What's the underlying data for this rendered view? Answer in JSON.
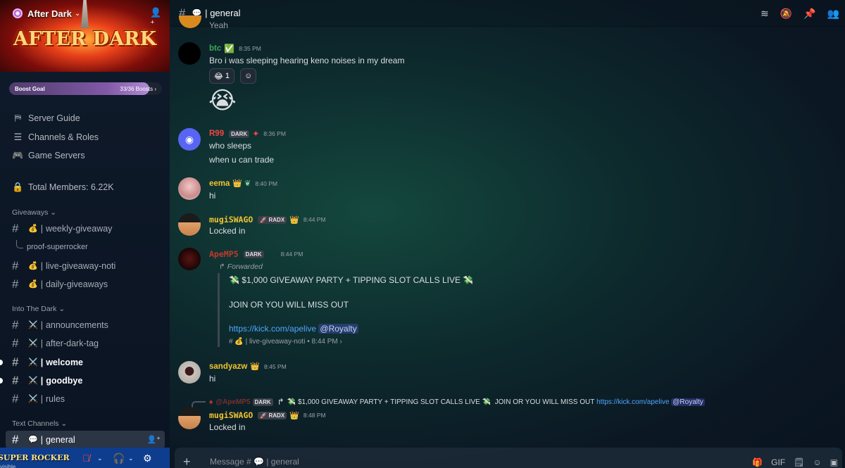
{
  "server": {
    "name": "After Dark",
    "banner_text": "AFTER DARK",
    "boost_goal_label": "Boost Goal",
    "boost_count": "33/36 Boosts",
    "boost_progress": 0.9167
  },
  "nav": {
    "server_guide": "Server Guide",
    "channels_roles": "Channels & Roles",
    "game_servers": "Game Servers",
    "total_members": "Total Members: 6.22K"
  },
  "categories": {
    "giveaways": "Giveaways",
    "into_the_dark": "Into The Dark",
    "text_channels": "Text Channels"
  },
  "channels": {
    "weekly_giveaway": "weekly-giveaway",
    "proof_superrocker": "proof-superrocker",
    "live_giveaway_noti": "live-giveaway-noti",
    "daily_giveaways": "daily-giveaways",
    "announcements": "announcements",
    "after_dark_tag": "after-dark-tag",
    "welcome": "welcome",
    "goodbye": "goodbye",
    "rules": "rules",
    "general": "general"
  },
  "separator": "|",
  "user": {
    "name": "SUPER ROCKER",
    "status": "visible"
  },
  "topbar": {
    "channel": "general"
  },
  "messages": [
    {
      "author": "btc",
      "author_color": "#3ba55d",
      "time": "8:35 PM",
      "lines": [
        "Bro i was sleeping hearing keno noises in my dream"
      ],
      "reaction_count": "1"
    },
    {
      "author": "R99",
      "author_color": "#f04747",
      "tag": "DARK",
      "time": "8:36 PM",
      "lines": [
        "who sleeps",
        "when u can trade"
      ]
    },
    {
      "author": "eema",
      "author_color": "#f0c330",
      "time": "8:40 PM",
      "lines": [
        "hi"
      ]
    },
    {
      "author": "mugiSWAGO",
      "author_color": "#f0c330",
      "tag": "RADX",
      "time": "8:44 PM",
      "lines": [
        "Locked in"
      ]
    },
    {
      "author": "ApeMP5",
      "author_color": "#c0392b",
      "tag": "DARK",
      "time": "8:44 PM",
      "forwarded_label": "Forwarded",
      "forward_title": "$1,000 GIVEAWAY PARTY + TIPPING SLOT CALLS LIVE",
      "forward_body": "JOIN OR YOU WILL MISS OUT",
      "forward_link": "https://kick.com/apelive",
      "forward_mention": "@Royalty",
      "forward_source": "| live-giveaway-noti",
      "forward_time": "8:44 PM"
    },
    {
      "author": "sandyazw",
      "author_color": "#f0c330",
      "time": "8:45 PM",
      "lines": [
        "hi"
      ]
    },
    {
      "author": "mugiSWAGO",
      "author_color": "#f0c330",
      "tag": "RADX",
      "time": "8:48 PM",
      "lines": [
        "Locked in"
      ],
      "reply_author": "@ApeMP5",
      "reply_tag": "DARK",
      "reply_text": "$1,000 GIVEAWAY PARTY + TIPPING SLOT CALLS LIVE",
      "reply_text2": "JOIN OR YOU WILL MISS OUT",
      "reply_link": "https://kick.com/apelive",
      "reply_mention": "@Royalty"
    }
  ],
  "top_partial_text": "Yeah",
  "composer": {
    "placeholder_prefix": "Message #",
    "placeholder_channel": "| general"
  }
}
